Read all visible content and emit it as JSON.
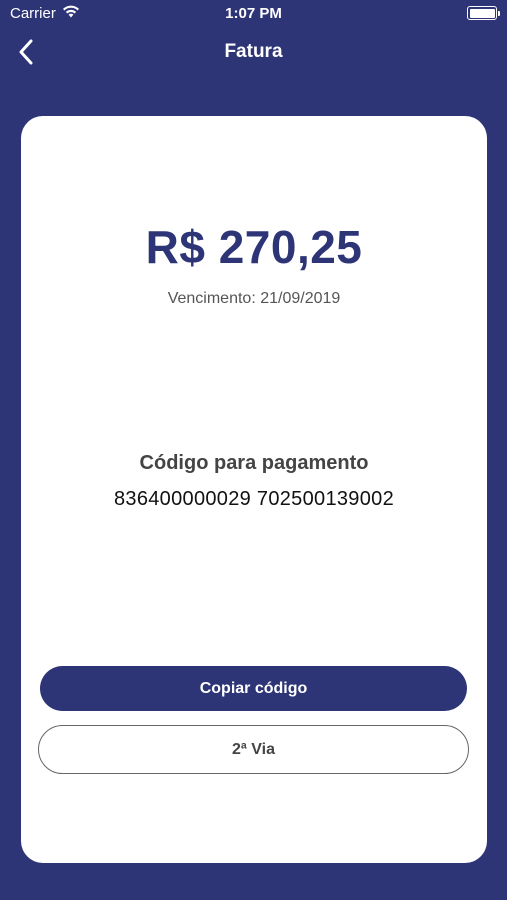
{
  "status_bar": {
    "carrier": "Carrier",
    "time": "1:07 PM",
    "wifi_icon": "wifi-icon",
    "battery_icon": "battery-icon"
  },
  "nav": {
    "title": "Fatura",
    "back_icon": "chevron-left-icon"
  },
  "invoice": {
    "amount": "R$ 270,25",
    "due_date": "Vencimento: 21/09/2019",
    "code_title": "Código para pagamento",
    "code_value": "836400000029 702500139002"
  },
  "actions": {
    "copy_label": "Copiar código",
    "second_copy_label": "2ª Via"
  },
  "colors": {
    "brand": "#2e3577",
    "card": "#ffffff"
  }
}
